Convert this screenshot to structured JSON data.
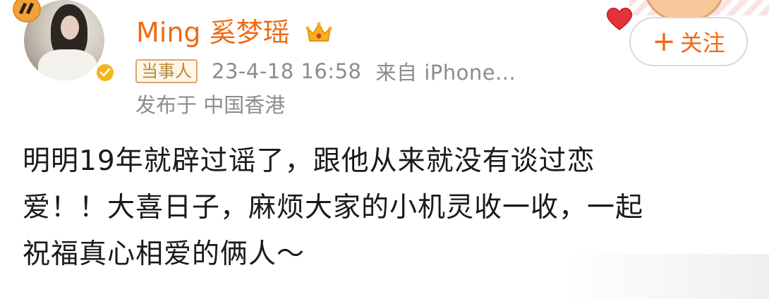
{
  "post": {
    "author": {
      "name": "Ming 奚梦瑶",
      "verified": true,
      "avatar_icon": "user-avatar",
      "vip_badge_icon": "crown-icon"
    },
    "role_tag": "当事人",
    "timestamp": "23-4-18 16:58",
    "source": "来自 iPhone...",
    "location": "发布于 中国香港",
    "follow_button": {
      "label": "关注",
      "icon": "plus-icon"
    },
    "body_lines": [
      "明明19年就辟过谣了，跟他从来就没有谈过恋",
      "爱！！大喜日子，麻烦大家的小机灵收一收，一起",
      "祝福真心相爱的俩人～"
    ]
  },
  "colors": {
    "accent_orange": "#f06a14",
    "meta_gray": "#8c8c8c",
    "tag_border": "#d6a96a",
    "verified_yellow": "#f5b417",
    "heart_red": "#e4323a"
  }
}
